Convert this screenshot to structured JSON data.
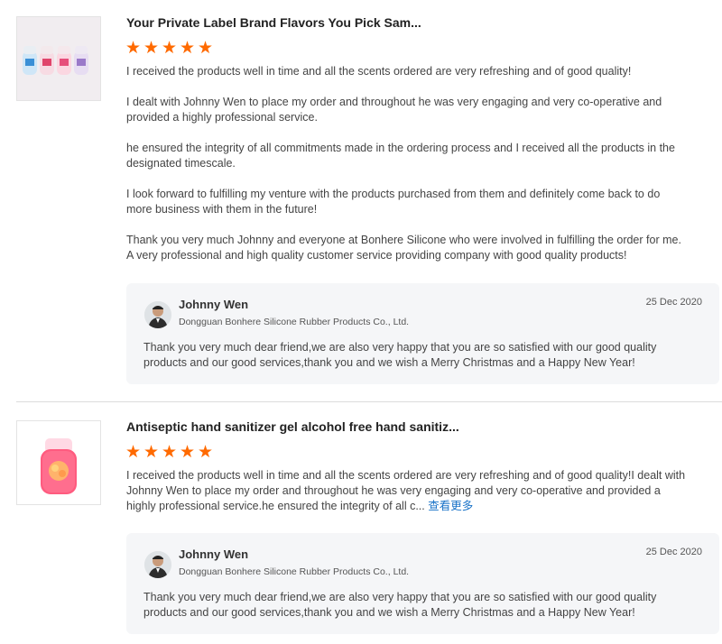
{
  "reviews": [
    {
      "title": "Your Private Label Brand Flavors You Pick Sam...",
      "rating": 5,
      "paragraphs": [
        "I received the products well in time and all the scents ordered are very refreshing and of good quality!",
        "I dealt with Johnny Wen to place my order and throughout he was very engaging and very co-operative and provided a highly professional service.",
        "he ensured the integrity of all commitments made in the ordering process and I received all the products in the designated timescale.",
        "I look forward to fulfilling my venture with the products purchased from them and definitely come back to do more business with them in the future!",
        "Thank you very much Johnny and everyone at Bonhere Silicone who were involved in fulfilling the order for me. A very professional and high quality customer service providing company with good quality products!"
      ],
      "reply": {
        "name": "Johnny Wen",
        "company": "Dongguan Bonhere Silicone Rubber Products Co., Ltd.",
        "date": "25 Dec 2020",
        "text": "Thank you very much dear friend,we are also very happy that you are so satisfied with our good quality products and our good services,thank you and we wish a Merry Christmas and a Happy New Year!"
      }
    },
    {
      "title": "Antiseptic hand sanitizer gel alcohol free hand sanitiz...",
      "rating": 5,
      "text": "I received the products well in time and all the scents ordered are very refreshing and of good quality!I dealt with Johnny Wen to place my order and throughout he was very engaging and very co-operative and provided a highly professional service.he ensured the integrity of all c...",
      "more_label": "查看更多",
      "reply": {
        "name": "Johnny Wen",
        "company": "Dongguan Bonhere Silicone Rubber Products Co., Ltd.",
        "date": "25 Dec 2020",
        "text": "Thank you very much dear friend,we are also very happy that you are so satisfied with our good quality products and our good services,thank you and we wish a Merry Christmas and a Happy New Year!"
      }
    }
  ],
  "colors": {
    "star": "#ff6a00",
    "link": "#1a73c8",
    "reply_bg": "#f5f6f8"
  }
}
